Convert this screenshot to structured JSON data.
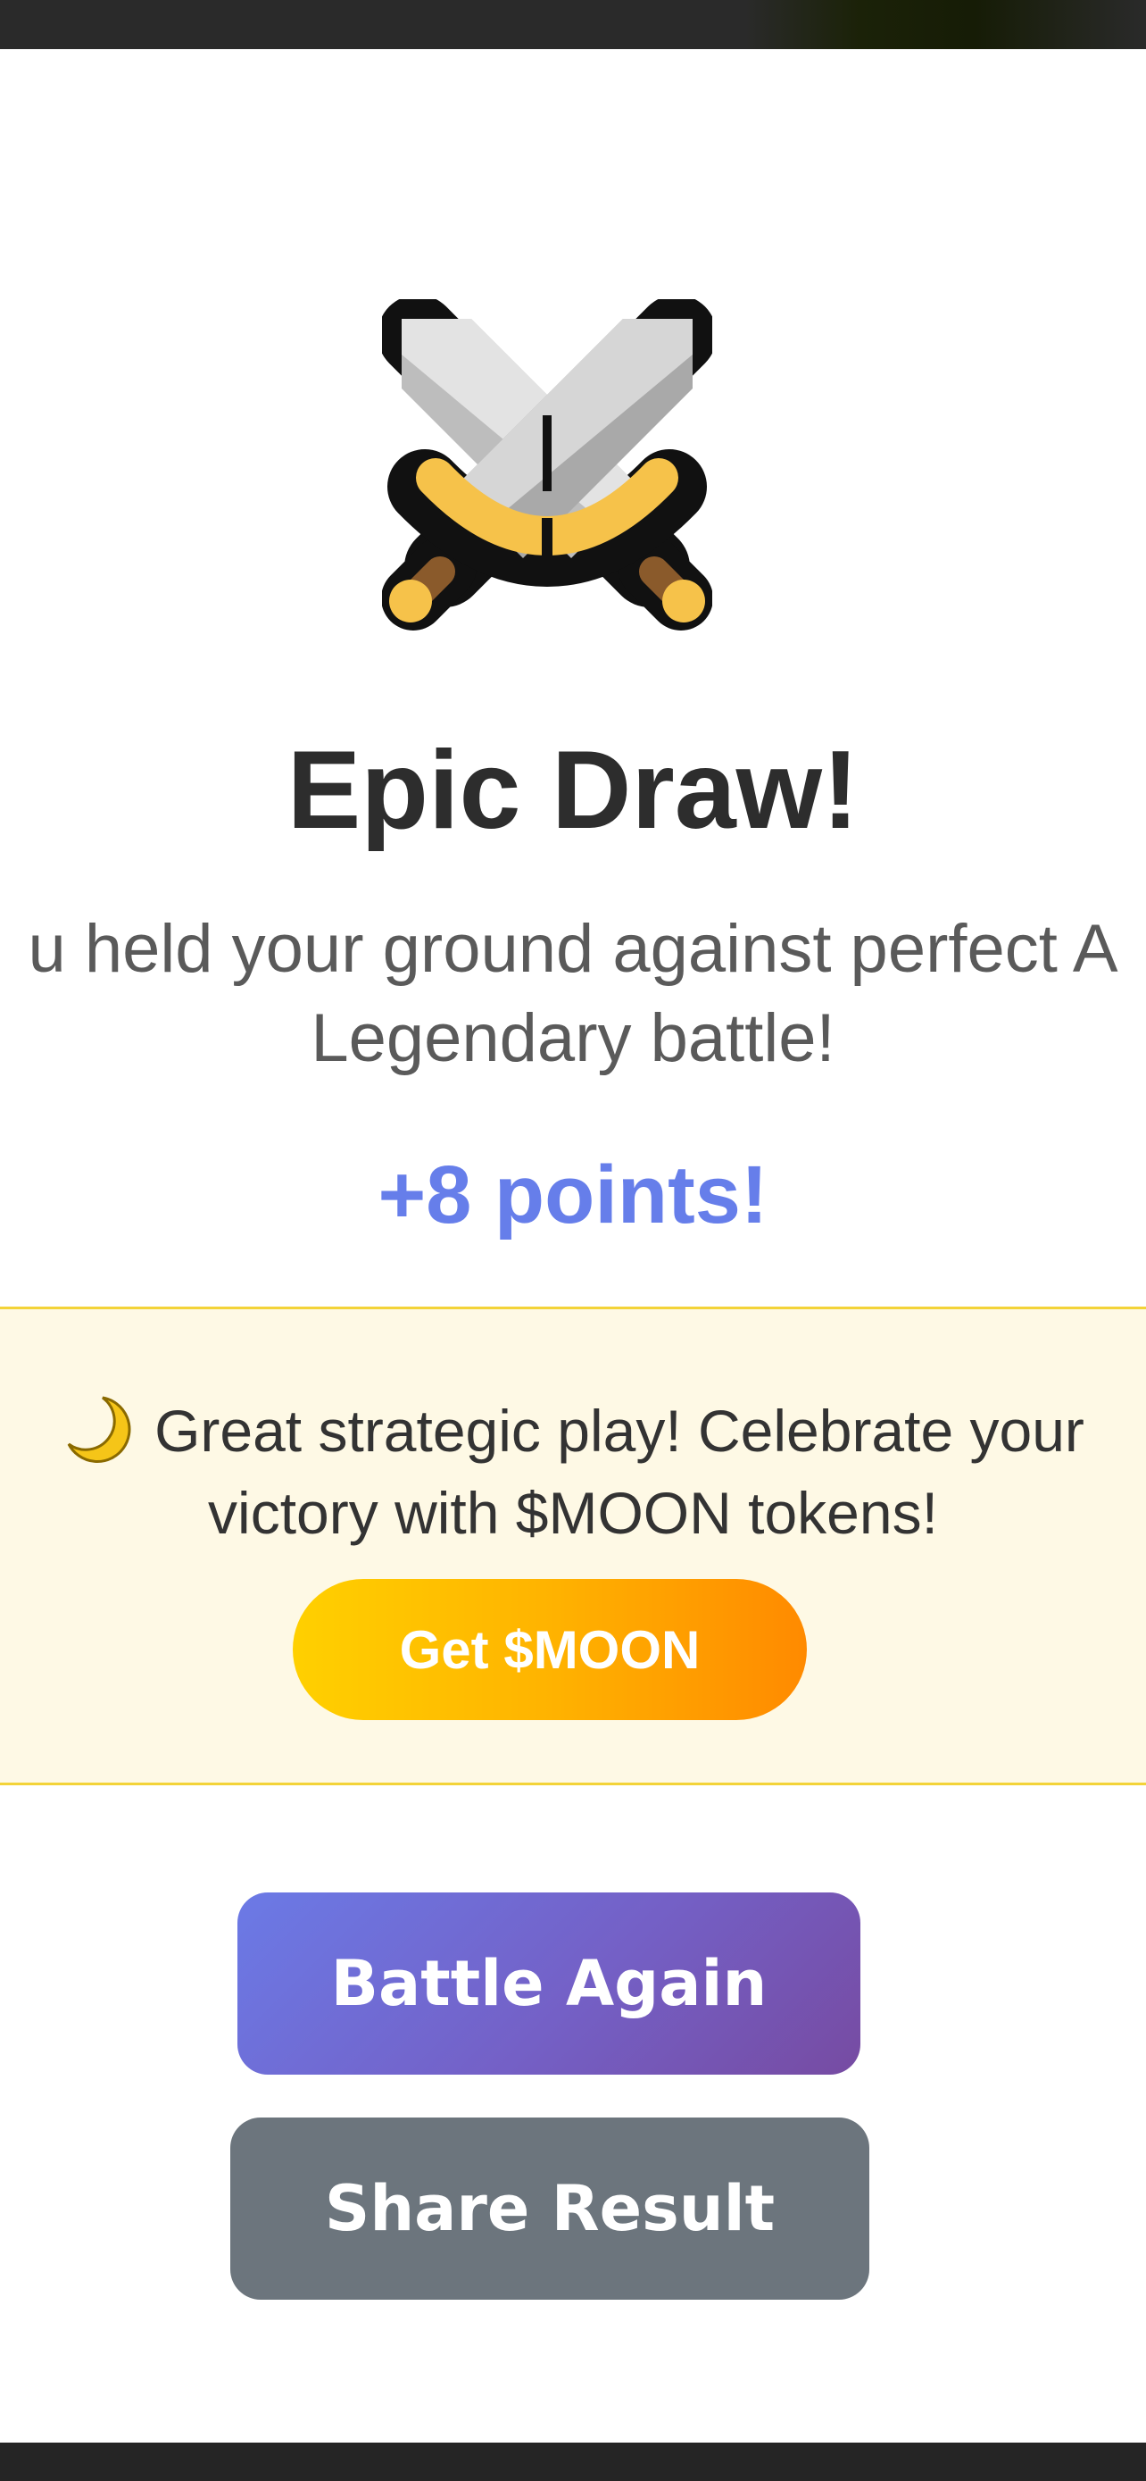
{
  "result": {
    "icon": "crossed-swords-icon",
    "title": "Epic Draw!",
    "message_line1": "u held your ground against perfect A",
    "message_line2": "Legendary battle!",
    "points": "+8 points!"
  },
  "promo": {
    "icon": "crescent-moon-icon",
    "text_line1": "Great strategic play! Celebrate your",
    "text_line2": "victory with $MOON tokens!",
    "button_label": "Get $MOON"
  },
  "actions": {
    "battle_again_label": "Battle Again",
    "share_result_label": "Share Result"
  },
  "colors": {
    "points": "#667eea",
    "promo_background": "#fef9e5",
    "promo_border": "#f3d338",
    "battle_again_gradient": [
      "#667eea",
      "#764ba2"
    ],
    "share_result": "#6c757d",
    "moon_button_gradient": [
      "#ffd000",
      "#ff8a00"
    ]
  }
}
